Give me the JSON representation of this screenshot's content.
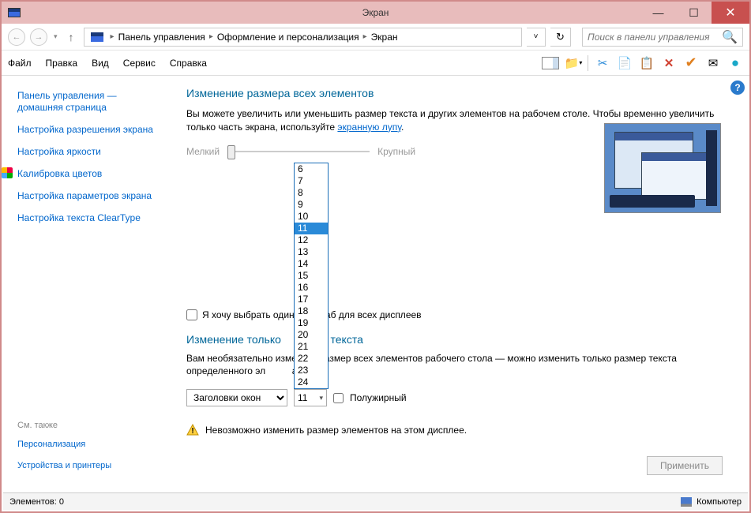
{
  "window": {
    "title": "Экран"
  },
  "nav": {
    "crumb1": "Панель управления",
    "crumb2": "Оформление и персонализация",
    "crumb3": "Экран",
    "search_placeholder": "Поиск в панели управления"
  },
  "menu": {
    "file": "Файл",
    "edit": "Правка",
    "view": "Вид",
    "service": "Сервис",
    "help": "Справка"
  },
  "sidebar": {
    "items": [
      "Панель управления — домашняя страница",
      "Настройка разрешения экрана",
      "Настройка яркости",
      "Калибровка цветов",
      "Настройка параметров экрана",
      "Настройка текста ClearType"
    ],
    "see_also_hdr": "См. также",
    "see_also": [
      "Персонализация",
      "Устройства и принтеры"
    ]
  },
  "main": {
    "h1": "Изменение размера всех элементов",
    "desc1": "Вы можете увеличить или уменьшить размер текста и других элементов на рабочем столе. Чтобы временно увеличить только часть экрана, используйте ",
    "desc_link": "экранную лупу",
    "slider_small": "Мелкий",
    "slider_large": "Крупный",
    "checkbox_label": "Я хочу выбрать один масштаб для всех дисплеев",
    "h2": "Изменение только размера текста",
    "desc2": "Вам необязательно изменять размер всех элементов рабочего стола — можно изменить только размер текста определенного элемента.",
    "select_value": "Заголовки окон",
    "size_value": "11",
    "size_options": [
      "6",
      "7",
      "8",
      "9",
      "10",
      "11",
      "12",
      "13",
      "14",
      "15",
      "16",
      "17",
      "18",
      "19",
      "20",
      "21",
      "22",
      "23",
      "24"
    ],
    "bold_label": "Полужирный",
    "warning": "Невозможно изменить размер элементов на этом дисплее.",
    "apply": "Применить"
  },
  "status": {
    "left": "Элементов: 0",
    "right": "Компьютер"
  }
}
